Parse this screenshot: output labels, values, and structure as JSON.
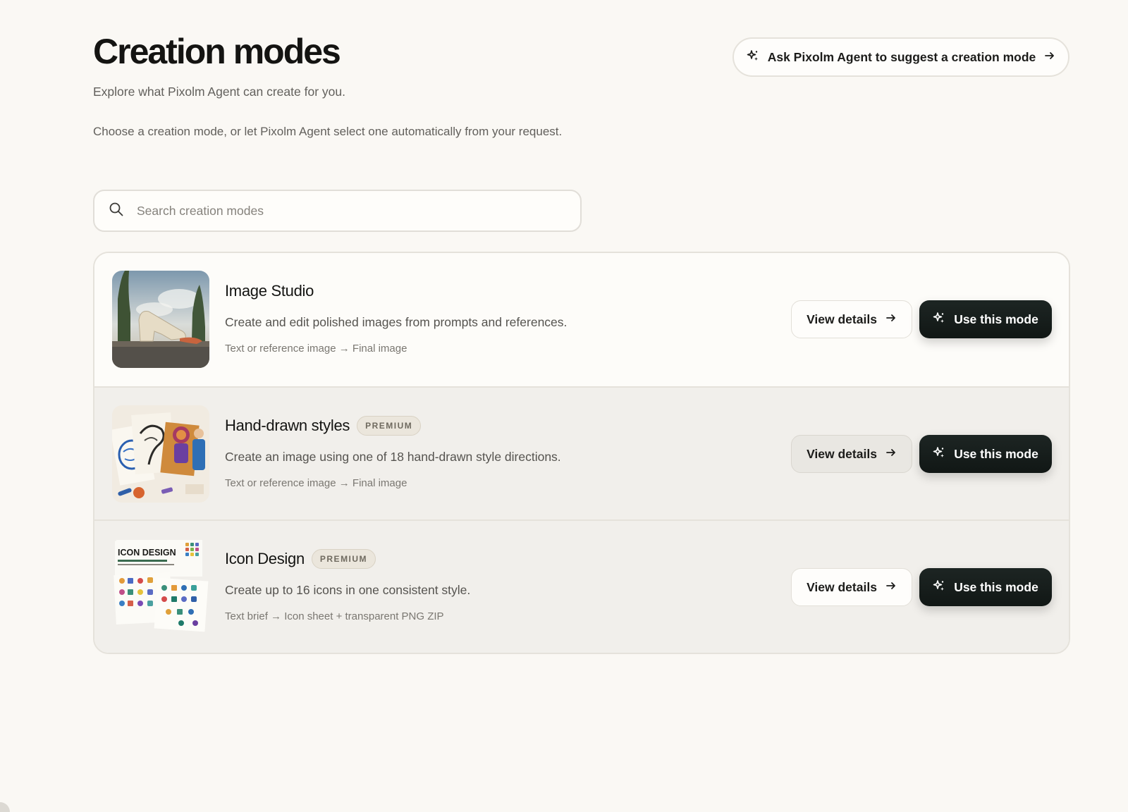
{
  "header": {
    "title": "Creation modes",
    "subtitle": "Explore what Pixolm Agent can create for you.",
    "intro": "Choose a creation mode, or let Pixolm Agent select one automatically from your request.",
    "suggest_button": {
      "label": "Ask Pixolm Agent to suggest a creation mode",
      "icon": "sparkle-icon",
      "trailing_icon": "arrow-right-icon"
    }
  },
  "search": {
    "placeholder": "Search creation modes",
    "value": "",
    "icon": "search-icon"
  },
  "modes": [
    {
      "name": "Image Studio",
      "badge": "",
      "description": "Create and edit polished images from prompts and references.",
      "flow": "Text or reference image → Final image",
      "view_label": "View details",
      "use_label": "Use this mode"
    },
    {
      "name": "Hand-drawn styles",
      "badge": "PREMIUM",
      "description": "Create an image using one of 18 hand-drawn style directions.",
      "flow": "Text or reference image → Final image",
      "view_label": "View details",
      "use_label": "Use this mode"
    },
    {
      "name": "Icon Design",
      "badge": "PREMIUM",
      "description": "Create up to 16 icons in one consistent style.",
      "flow": "Text brief → Icon sheet + transparent PNG ZIP",
      "view_label": "View details",
      "use_label": "Use this mode",
      "thumbnail_text": "ICON DESIGN"
    }
  ],
  "colors": {
    "background": "#faf8f4",
    "primary_button": "#141b19",
    "badge_background": "#ebe6dc",
    "text_muted": "#62605c"
  }
}
